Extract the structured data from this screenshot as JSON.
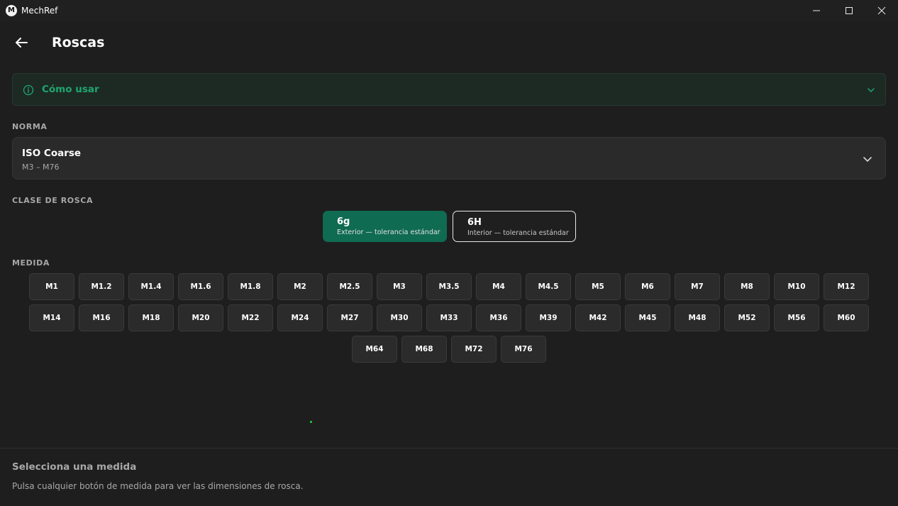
{
  "window": {
    "app_title": "MechRef",
    "logo_letter": "M"
  },
  "header": {
    "title": "Roscas"
  },
  "howto": {
    "label": "Cómo usar"
  },
  "norma": {
    "section_label": "NORMA",
    "selected": "ISO Coarse",
    "range": "M3 – M76"
  },
  "thread_class": {
    "section_label": "CLASE DE ROSCA",
    "options": [
      {
        "title": "6g",
        "subtitle": "Exterior — tolerancia estándar",
        "selected": true
      },
      {
        "title": "6H",
        "subtitle": "Interior — tolerancia estándar",
        "selected": false
      }
    ]
  },
  "sizes": {
    "section_label": "MEDIDA",
    "rows": [
      [
        "M1",
        "M1.2",
        "M1.4",
        "M1.6",
        "M1.8",
        "M2",
        "M2.5",
        "M3",
        "M3.5",
        "M4",
        "M4.5",
        "M5",
        "M6",
        "M7",
        "M8",
        "M10",
        "M12"
      ],
      [
        "M14",
        "M16",
        "M18",
        "M20",
        "M22",
        "M24",
        "M27",
        "M30",
        "M33",
        "M36",
        "M39",
        "M42",
        "M45",
        "M48",
        "M52",
        "M56",
        "M60"
      ],
      [
        "M64",
        "M68",
        "M72",
        "M76"
      ]
    ]
  },
  "footer": {
    "title": "Selecciona una medida",
    "text": "Pulsa cualquier botón de medida para ver las dimensiones de rosca."
  },
  "colors": {
    "accent": "#0f6b52",
    "accent_text": "#1fa66f",
    "background": "#1e1e1e"
  }
}
